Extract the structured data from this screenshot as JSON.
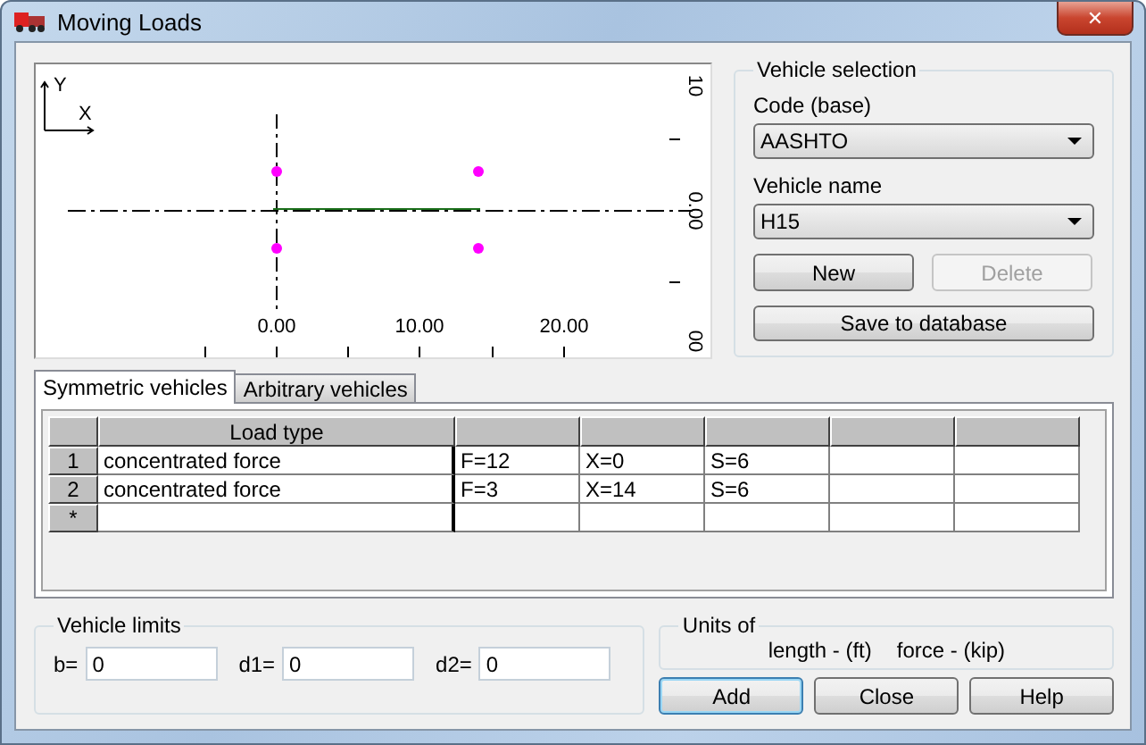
{
  "window": {
    "title": "Moving Loads",
    "close": "✕"
  },
  "plot": {
    "axis_x": "X",
    "axis_y": "Y",
    "x_labels": [
      "0.00",
      "10.00",
      "20.00"
    ],
    "y_labels": [
      "10",
      "0.00",
      "00"
    ]
  },
  "vehicle_selection": {
    "title": "Vehicle selection",
    "code_label": "Code (base)",
    "code_value": "AASHTO",
    "name_label": "Vehicle name",
    "name_value": "H15",
    "buttons": [
      {
        "label": "New",
        "disabled": false
      },
      {
        "label": "Delete",
        "disabled": true
      }
    ],
    "save": "Save to database"
  },
  "tabs": [
    {
      "label": "Symmetric vehicles",
      "selected": true
    },
    {
      "label": "Arbitrary vehicles",
      "selected": false
    }
  ],
  "table": {
    "columns": [
      "Load type",
      "",
      "",
      "",
      "",
      ""
    ],
    "rows": [
      {
        "header": "1",
        "cells": [
          "concentrated force",
          "F=12",
          "X=0",
          "S=6",
          "",
          ""
        ]
      },
      {
        "header": "2",
        "cells": [
          "concentrated force",
          "F=3",
          "X=14",
          "S=6",
          "",
          ""
        ]
      },
      {
        "header": "*",
        "cells": [
          "",
          "",
          "",
          "",
          "",
          ""
        ]
      }
    ]
  },
  "vehicle_limits": {
    "title": "Vehicle limits",
    "fields": [
      {
        "label": "b=",
        "value": "0"
      },
      {
        "label": "d1=",
        "value": "0"
      },
      {
        "label": "d2=",
        "value": "0"
      }
    ]
  },
  "units": {
    "title": "Units of",
    "length": "length - (ft)",
    "force": "force - (kip)"
  },
  "buttons": [
    {
      "label": "Add",
      "selected": true
    },
    {
      "label": "Close",
      "selected": false
    },
    {
      "label": "Help",
      "selected": false
    }
  ]
}
